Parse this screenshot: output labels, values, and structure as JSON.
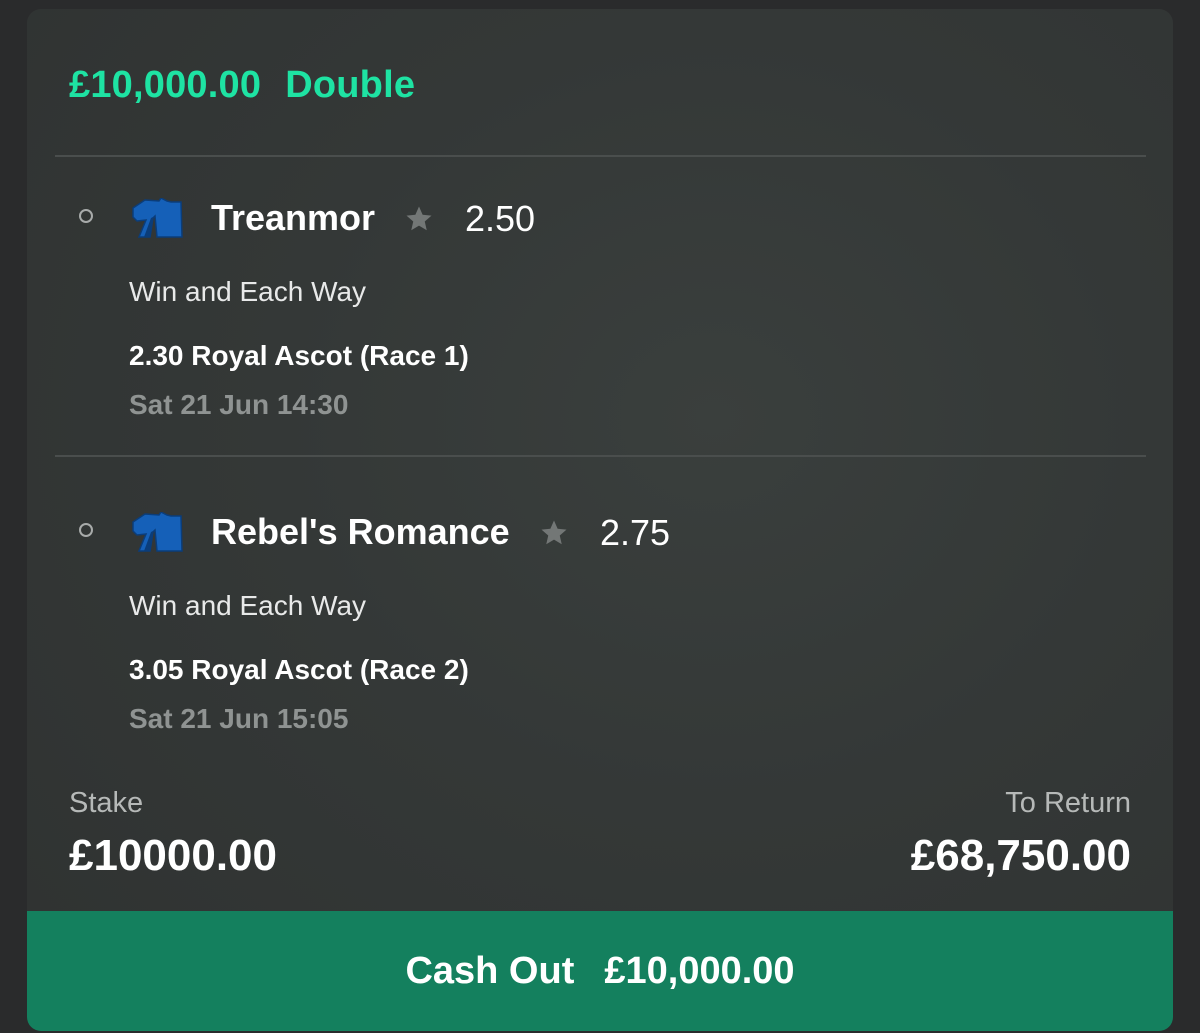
{
  "bet": {
    "stake_header": "£10,000.00",
    "bet_type": "Double"
  },
  "selections": [
    {
      "name": "Treanmor",
      "odds": "2.50",
      "market": "Win and Each Way",
      "event": "2.30 Royal Ascot (Race 1)",
      "event_time": "Sat 21 Jun 14:30",
      "icons": [
        "radio-status-icon",
        "jockey-silk-icon",
        "star-icon"
      ]
    },
    {
      "name": "Rebel's Romance",
      "odds": "2.75",
      "market": "Win and Each Way",
      "event": "3.05 Royal Ascot (Race 2)",
      "event_time": "Sat 21 Jun 15:05",
      "icons": [
        "radio-status-icon",
        "jockey-silk-icon",
        "star-icon"
      ]
    }
  ],
  "summary": {
    "stake_label": "Stake",
    "stake_value": "£10000.00",
    "return_label": "To Return",
    "return_value": "£68,750.00"
  },
  "cash_out": {
    "label": "Cash Out",
    "amount": "£10,000.00"
  },
  "colors": {
    "accent_green": "#1ee3a3",
    "cash_out_bg": "#14805e",
    "silk_blue": "#1560b8"
  }
}
